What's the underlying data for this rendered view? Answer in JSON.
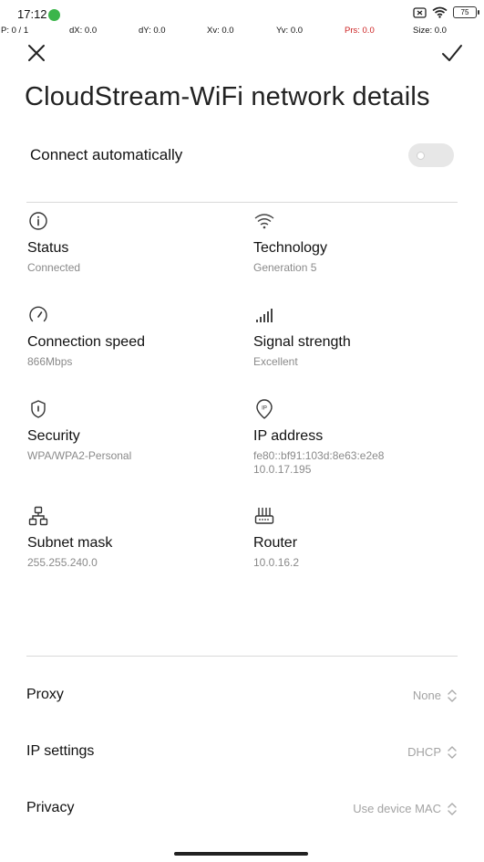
{
  "status_bar": {
    "time": "17:12",
    "battery": "75"
  },
  "debug": {
    "p": "P: 0 / 1",
    "dx": "dX: 0.0",
    "dy": "dY: 0.0",
    "xv": "Xv: 0.0",
    "yv": "Yv: 0.0",
    "prs": "Prs: 0.0",
    "size": "Size: 0.0"
  },
  "header": {
    "title": "CloudStream-WiFi network details",
    "close_icon": "close-icon",
    "confirm_icon": "check-icon"
  },
  "auto_connect": {
    "label": "Connect automatically",
    "enabled": false
  },
  "details": {
    "status": {
      "label": "Status",
      "value": "Connected",
      "icon": "info-icon"
    },
    "technology": {
      "label": "Technology",
      "value": "Generation 5",
      "icon": "wifi-icon"
    },
    "speed": {
      "label": "Connection speed",
      "value": "866Mbps",
      "icon": "speedometer-icon"
    },
    "signal": {
      "label": "Signal strength",
      "value": "Excellent",
      "icon": "signal-bars-icon"
    },
    "security": {
      "label": "Security",
      "value": "WPA/WPA2-Personal",
      "icon": "shield-icon"
    },
    "ip": {
      "label": "IP address",
      "value_v6": "fe80::bf91:103d:8e63:e2e8",
      "value_v4": "10.0.17.195",
      "icon": "ip-pin-icon"
    },
    "subnet": {
      "label": "Subnet mask",
      "value": "255.255.240.0",
      "icon": "network-tree-icon"
    },
    "router": {
      "label": "Router",
      "value": "10.0.16.2",
      "icon": "router-icon"
    }
  },
  "settings": {
    "proxy": {
      "label": "Proxy",
      "value": "None"
    },
    "ip_settings": {
      "label": "IP settings",
      "value": "DHCP"
    },
    "privacy": {
      "label": "Privacy",
      "value": "Use device MAC"
    }
  },
  "colors": {
    "accent_status_dot": "#3ab54a",
    "secondary_text": "#8a8a8a",
    "divider": "#d9d9d9"
  }
}
